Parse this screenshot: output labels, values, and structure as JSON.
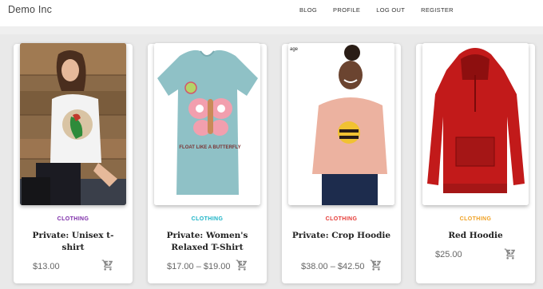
{
  "header": {
    "brand": "Demo Inc",
    "nav": [
      "BLOG",
      "PROFILE",
      "LOG OUT",
      "REGISTER"
    ]
  },
  "products": [
    {
      "category": "CLOTHING",
      "category_color": "#7b2aa8",
      "title": "Private: Unisex t-shirt",
      "price": "$13.00"
    },
    {
      "category": "CLOTHING",
      "category_color": "#19b3c6",
      "title": "Private: Women's Relaxed T-Shirt",
      "price": "$17.00 – $19.00"
    },
    {
      "category": "CLOTHING",
      "category_color": "#e53935",
      "title": "Private: Crop Hoodie",
      "price": "$38.00 – $42.50"
    },
    {
      "category": "CLOTHING",
      "category_color": "#f0a020",
      "title": "Red Hoodie",
      "price": "$25.00"
    }
  ],
  "product_images": [
    "woman-in-parrot-tshirt-photo",
    "light-blue-butterfly-tshirt",
    "woman-in-peach-bee-crop-hoodie",
    "red-hoodie"
  ],
  "shirt_print_text": "FLOAT LIKE A BUTTERFLY",
  "image_stray_text": "age",
  "icons": {
    "cart": "cart-icon"
  }
}
